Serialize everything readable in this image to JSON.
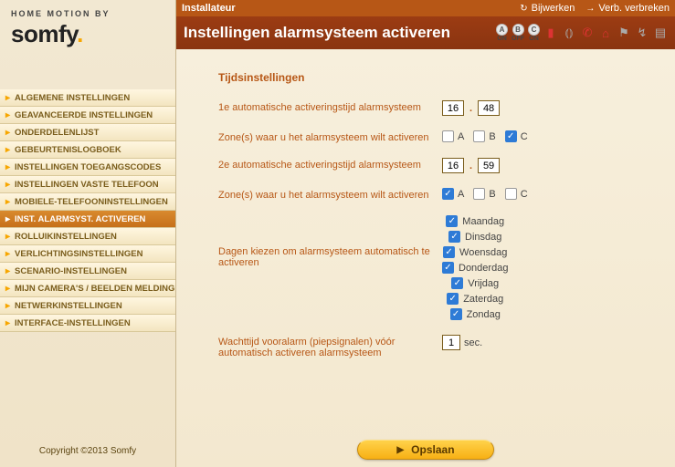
{
  "brand": {
    "tagline": "HOME MOTION BY",
    "logo": "somfy",
    "dot": "."
  },
  "copyright": "Copyright ©2013 Somfy",
  "topbar": {
    "title": "Installateur",
    "refresh": "Bijwerken",
    "disconnect": "Verb. verbreken"
  },
  "banner": {
    "title": "Instellingen alarmsysteem activeren",
    "modes": [
      {
        "letter": "A",
        "state": "ON"
      },
      {
        "letter": "B",
        "state": "OFF"
      },
      {
        "letter": "C",
        "state": "ON"
      }
    ]
  },
  "nav": [
    "ALGEMENE INSTELLINGEN",
    "GEAVANCEERDE INSTELLINGEN",
    "ONDERDELENLIJST",
    "GEBEURTENISLOGBOEK",
    "INSTELLINGEN TOEGANGSCODES",
    "INSTELLINGEN VASTE TELEFOON",
    "MOBIELE-TELEFOONINSTELLINGEN",
    "INST. ALARMSYST. ACTIVEREN",
    "ROLLUIKINSTELLINGEN",
    "VERLICHTINGSINSTELLINGEN",
    "SCENARIO-INSTELLINGEN",
    "MIJN CAMERA'S / BEELDEN MELDING",
    "NETWERKINSTELLINGEN",
    "INTERFACE-INSTELLINGEN"
  ],
  "nav_active_index": 7,
  "section_title": "Tijdsinstellingen",
  "labels": {
    "time1": "1e automatische activeringstijd alarmsysteem",
    "zones1": "Zone(s) waar u het alarmsysteem wilt activeren",
    "time2": "2e automatische activeringstijd alarmsysteem",
    "zones2": "Zone(s) waar u het alarmsysteem wilt activeren",
    "days": "Dagen kiezen om alarmsysteem automatisch te activeren",
    "prealarm": "Wachttijd vooralarm (piepsignalen) vóór automatisch activeren alarmsysteem"
  },
  "values": {
    "time1_h": "16",
    "time1_m": "48",
    "time2_h": "16",
    "time2_m": "59",
    "zones1": {
      "A": false,
      "B": false,
      "C": true
    },
    "zones2": {
      "A": true,
      "B": false,
      "C": false
    },
    "days": {
      "Maandag": true,
      "Dinsdag": true,
      "Woensdag": true,
      "Donderdag": true,
      "Vrijdag": true,
      "Zaterdag": true,
      "Zondag": true
    },
    "prealarm": "1",
    "sec_suffix": "sec."
  },
  "zone_names": [
    "A",
    "B",
    "C"
  ],
  "day_names": [
    "Maandag",
    "Dinsdag",
    "Woensdag",
    "Donderdag",
    "Vrijdag",
    "Zaterdag",
    "Zondag"
  ],
  "save_label": "Opslaan"
}
